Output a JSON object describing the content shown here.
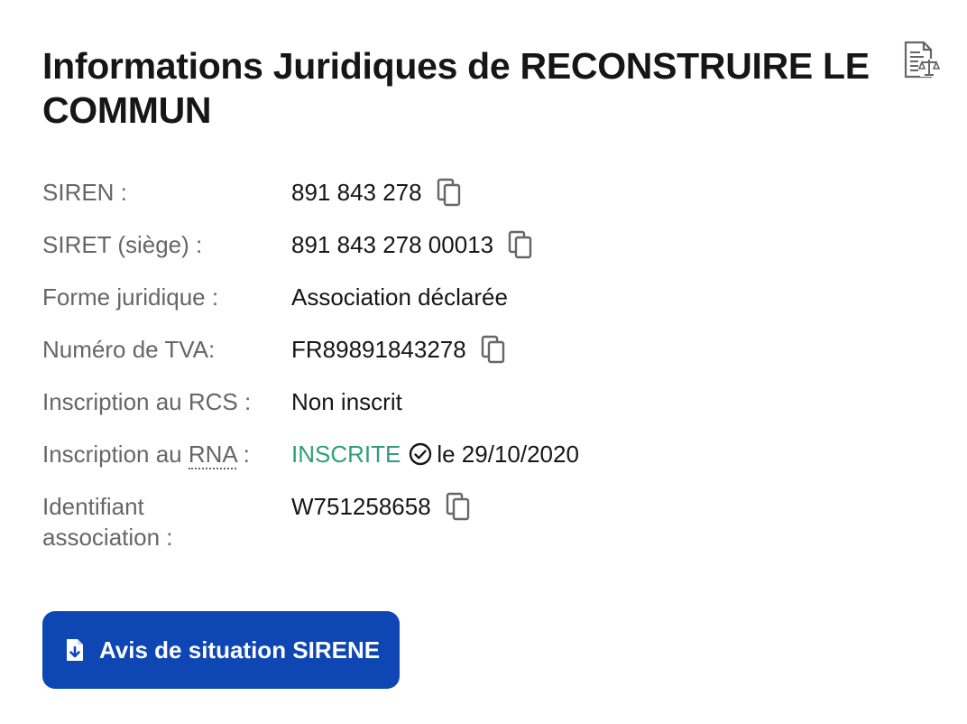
{
  "header": {
    "title": "Informations Juridiques de RECONSTRUIRE LE COMMUN",
    "icon": "legal-document-icon"
  },
  "rows": [
    {
      "label": "SIREN :",
      "value": "891 843 278",
      "copyable": true
    },
    {
      "label": "SIRET (siège) :",
      "value": "891 843 278 00013",
      "copyable": true
    },
    {
      "label": "Forme juridique :",
      "value": "Association déclarée",
      "copyable": false
    },
    {
      "label": "Numéro de TVA:",
      "value": "FR89891843278",
      "copyable": true
    },
    {
      "label": "Inscription au RCS :",
      "value": "Non inscrit",
      "copyable": false
    },
    {
      "label_prefix": "Inscription au ",
      "label_abbr": "RNA",
      "label_suffix": " :",
      "status": "INSCRITE",
      "date_text": "le 29/10/2020",
      "copyable": false
    },
    {
      "label": "Identifiant association :",
      "value": "W751258658",
      "copyable": true
    }
  ],
  "button": {
    "label": "Avis de situation SIRENE",
    "icon": "file-download-icon"
  },
  "colors": {
    "primary": "#0e47b3",
    "success": "#2e9f7a",
    "label": "#666666",
    "text": "#161616"
  }
}
